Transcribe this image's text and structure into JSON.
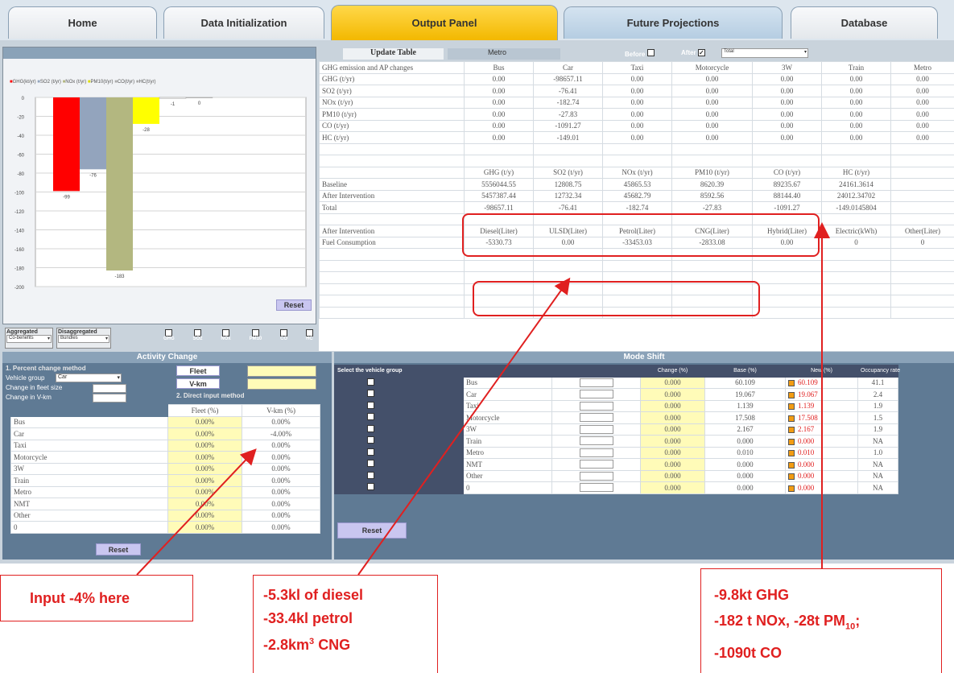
{
  "tabs": [
    "Home",
    "Data Initialization",
    "Output Panel",
    "Future Projections",
    "Database"
  ],
  "chart_data": {
    "type": "bar",
    "legend": [
      "GHG(kt/yr)",
      "SO2 (t/yr)",
      "NOx (t/yr)",
      "PM10(t/yr)",
      "CO(t/yr)",
      "HC(t/yr)"
    ],
    "categories": [
      "GHG",
      "SO2",
      "NOx",
      "PM10",
      "CO",
      "HC"
    ],
    "values": [
      -99,
      -76,
      -183,
      -28,
      -1,
      0
    ],
    "data_labels": [
      "-99",
      "-76",
      "-183",
      "-28",
      "-1",
      "0"
    ],
    "colors": [
      "#ff0000",
      "#93a4bd",
      "#b3b780",
      "#ffff00",
      "#ffffff",
      "#ffffff"
    ],
    "ylim": [
      -200,
      0
    ],
    "yticks": [
      0,
      -20,
      -40,
      -60,
      -80,
      -100,
      -120,
      -140,
      -160,
      -180,
      -200
    ]
  },
  "chart_controls": {
    "reset": "Reset",
    "aggregated": "Aggregated",
    "aggregated_value": "Co-benefits",
    "disaggregated": "Disaggregated",
    "disaggregated_value": "Bundles",
    "checks": [
      "GHG",
      "SO2",
      "NOx",
      "PM10",
      "CO",
      "HC"
    ]
  },
  "update": {
    "label": "Update Table",
    "group": "Metro",
    "before": "Before",
    "after": "After",
    "after_select": "Total"
  },
  "emission_table": {
    "headers": [
      "GHG emission and AP changes",
      "Bus",
      "Car",
      "Taxi",
      "Motorcycle",
      "3W",
      "Train",
      "Metro"
    ],
    "rows": [
      [
        "GHG (t/yr)",
        "0.00",
        "-98657.11",
        "0.00",
        "0.00",
        "0.00",
        "0.00",
        "0.00"
      ],
      [
        "SO2 (t/yr)",
        "0.00",
        "-76.41",
        "0.00",
        "0.00",
        "0.00",
        "0.00",
        "0.00"
      ],
      [
        "NOx (t/yr)",
        "0.00",
        "-182.74",
        "0.00",
        "0.00",
        "0.00",
        "0.00",
        "0.00"
      ],
      [
        "PM10 (t/yr)",
        "0.00",
        "-27.83",
        "0.00",
        "0.00",
        "0.00",
        "0.00",
        "0.00"
      ],
      [
        "CO (t/yr)",
        "0.00",
        "-1091.27",
        "0.00",
        "0.00",
        "0.00",
        "0.00",
        "0.00"
      ],
      [
        "HC (t/yr)",
        "0.00",
        "-149.01",
        "0.00",
        "0.00",
        "0.00",
        "0.00",
        "0.00"
      ]
    ]
  },
  "totals_table": {
    "headers": [
      "GHG (t/y)",
      "SO2 (t/yr)",
      "NOx (t/yr)",
      "PM10 (t/yr)",
      "CO (t/yr)",
      "HC (t/yr)"
    ],
    "rows": [
      [
        "Baseline",
        "5556044.55",
        "12808.75",
        "45865.53",
        "8620.39",
        "89235.67",
        "24161.3614"
      ],
      [
        "After Intervention",
        "5457387.44",
        "12732.34",
        "45682.79",
        "8592.56",
        "88144.40",
        "24012.34702"
      ],
      [
        "Total",
        "-98657.11",
        "-76.41",
        "-182.74",
        "-27.83",
        "-1091.27",
        "-149.0145804"
      ]
    ]
  },
  "fuel_table": {
    "label1": "After Intervention",
    "label2": "Fuel Consumption",
    "headers": [
      "Diesel(Liter)",
      "ULSD(Liter)",
      "Petrol(Liter)",
      "CNG(Liter)",
      "Hybrid(Liter)",
      "Electric(kWh)",
      "Other(Liter)"
    ],
    "values": [
      "-5330.73",
      "0.00",
      "-33453.03",
      "-2833.08",
      "0.00",
      "0",
      "0"
    ]
  },
  "activity": {
    "title": "Activity Change",
    "method1": "1. Percent change method",
    "vehicle_group_label": "Vehicle group",
    "vehicle_group_value": "Car",
    "fleet_size_label": "Change in fleet size",
    "vkm_label": "Change in V-km",
    "method2": "2. Direct input method",
    "fleet_btn": "Fleet",
    "vkm_btn": "V-km",
    "col_fleet": "Fleet (%)",
    "col_vkm": "V-km (%)",
    "rows": [
      [
        "Bus",
        "0.00%",
        "0.00%"
      ],
      [
        "Car",
        "0.00%",
        "-4.00%"
      ],
      [
        "Taxi",
        "0.00%",
        "0.00%"
      ],
      [
        "Motorcycle",
        "0.00%",
        "0.00%"
      ],
      [
        "3W",
        "0.00%",
        "0.00%"
      ],
      [
        "Train",
        "0.00%",
        "0.00%"
      ],
      [
        "Metro",
        "0.00%",
        "0.00%"
      ],
      [
        "NMT",
        "0.00%",
        "0.00%"
      ],
      [
        "Other",
        "0.00%",
        "0.00%"
      ],
      [
        "0",
        "0.00%",
        "0.00%"
      ]
    ],
    "reset": "Reset"
  },
  "mode_shift": {
    "title": "Mode Shift",
    "select_label": "Select the vehicle group",
    "headers": [
      "Change (%)",
      "Base (%)",
      "New (%)",
      "Occupancy rate"
    ],
    "rows": [
      [
        "Bus",
        "0.000",
        "60.109",
        "60.109",
        "41.1"
      ],
      [
        "Car",
        "0.000",
        "19.067",
        "19.067",
        "2.4"
      ],
      [
        "Taxi",
        "0.000",
        "1.139",
        "1.139",
        "1.9"
      ],
      [
        "Motorcycle",
        "0.000",
        "17.508",
        "17.508",
        "1.5"
      ],
      [
        "3W",
        "0.000",
        "2.167",
        "2.167",
        "1.9"
      ],
      [
        "Train",
        "0.000",
        "0.000",
        "0.000",
        "NA"
      ],
      [
        "Metro",
        "0.000",
        "0.010",
        "0.010",
        "1.0"
      ],
      [
        "NMT",
        "0.000",
        "0.000",
        "0.000",
        "NA"
      ],
      [
        "Other",
        "0.000",
        "0.000",
        "0.000",
        "NA"
      ],
      [
        "0",
        "0.000",
        "0.000",
        "0.000",
        "NA"
      ]
    ],
    "reset": "Reset"
  },
  "callouts": {
    "c1": "Input -4% here",
    "c2": [
      "-5.3kl of diesel",
      "-33.4kl petrol",
      "-2.8km",
      "3",
      "CNG"
    ],
    "c3": [
      "-9.8kt GHG",
      "-182 t NOx, -28t PM",
      "10",
      ";",
      "-1090t CO"
    ]
  }
}
